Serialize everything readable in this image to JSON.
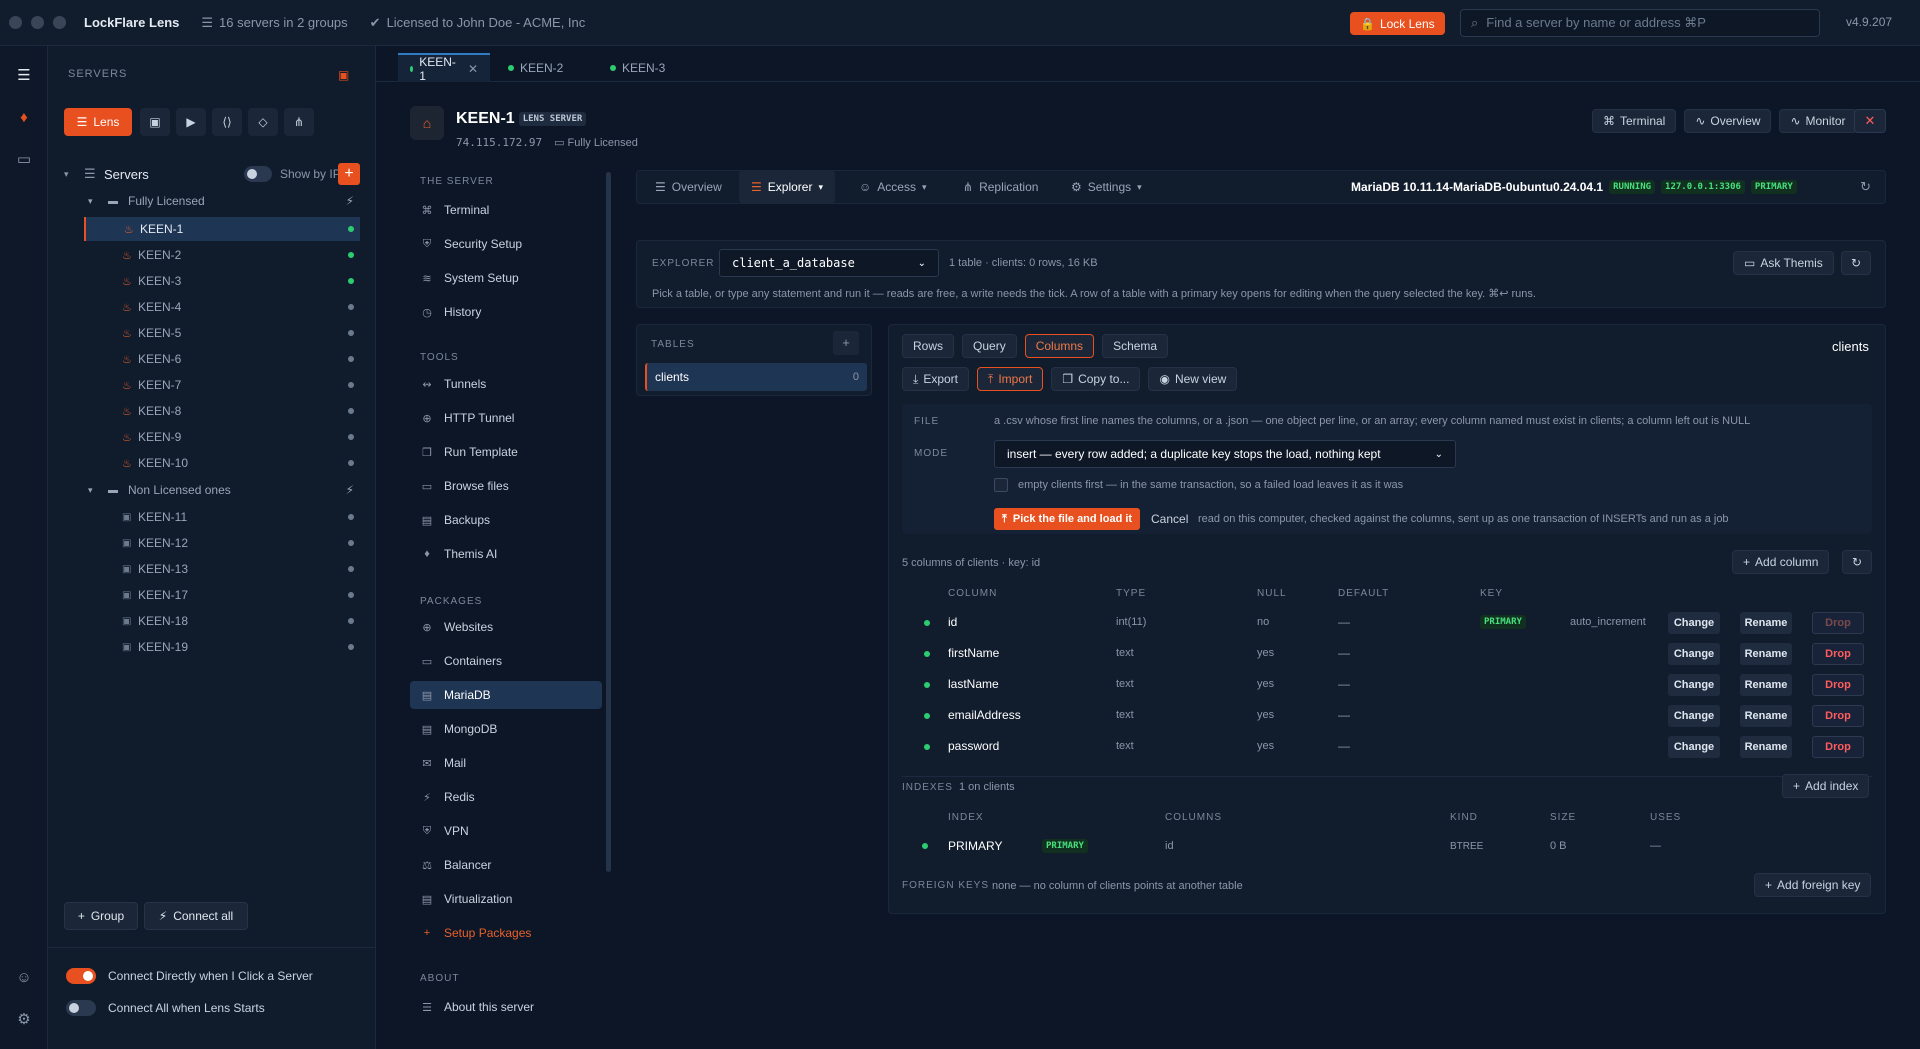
{
  "titlebar": {
    "app_title": "LockFlare Lens",
    "servers_info": "16 servers in 2 groups",
    "license_info": "Licensed to John Doe - ACME, Inc",
    "lock_label": "Lock Lens",
    "search_placeholder": "Find a server by name or address ⌘P",
    "version": "v4.9.207"
  },
  "sidebar": {
    "heading": "SERVERS",
    "lens_label": "Lens",
    "servers_label": "Servers",
    "show_by_ip": "Show by IP",
    "groups": [
      {
        "name": "Fully Licensed"
      },
      {
        "name": "Non Licensed ones"
      }
    ],
    "licensed_servers": [
      "KEEN-1",
      "KEEN-2",
      "KEEN-3",
      "KEEN-4",
      "KEEN-5",
      "KEEN-6",
      "KEEN-7",
      "KEEN-8",
      "KEEN-9",
      "KEEN-10"
    ],
    "unlicensed_servers": [
      "KEEN-11",
      "KEEN-12",
      "KEEN-13",
      "KEEN-17",
      "KEEN-18",
      "KEEN-19"
    ],
    "group_button": "Group",
    "connect_all_button": "Connect all",
    "opt_connect_direct": "Connect Directly when I Click a Server",
    "opt_connect_all_start": "Connect All when Lens Starts"
  },
  "tabs": [
    "KEEN-1",
    "KEEN-2",
    "KEEN-3"
  ],
  "server": {
    "name": "KEEN-1",
    "badge": "LENS SERVER",
    "ip": "74.115.172.97",
    "license": "Fully Licensed",
    "header_buttons": [
      "Terminal",
      "Overview",
      "Monitor"
    ]
  },
  "nav": {
    "sections": [
      "THE SERVER",
      "TOOLS",
      "PACKAGES",
      "ABOUT"
    ],
    "server_items": [
      "Terminal",
      "Security Setup",
      "System Setup",
      "History"
    ],
    "tool_items": [
      "Tunnels",
      "HTTP Tunnel",
      "Run Template",
      "Browse files",
      "Backups",
      "Themis AI"
    ],
    "package_items": [
      "Websites",
      "Containers",
      "MariaDB",
      "MongoDB",
      "Mail",
      "Redis",
      "VPN",
      "Balancer",
      "Virtualization",
      "Setup Packages"
    ],
    "about_items": [
      "About this server"
    ]
  },
  "db_tabs": [
    "Overview",
    "Explorer",
    "Access",
    "Replication",
    "Settings"
  ],
  "db_status": {
    "version": "MariaDB 10.11.14-MariaDB-0ubuntu0.24.04.1",
    "state": "RUNNING",
    "address": "127.0.0.1:3306",
    "role": "PRIMARY"
  },
  "explorer": {
    "label": "EXPLORER",
    "database": "client_a_database",
    "summary": "1 table · clients: 0 rows, 16 KB",
    "hint": "Pick a table, or type any statement and run it — reads are free, a write needs the tick. A row of a table with a primary key opens for editing when the query selected the key. ⌘↩ runs.",
    "ask_button": "Ask Themis"
  },
  "tables": {
    "heading": "TABLES",
    "items": [
      {
        "name": "clients",
        "count": "0"
      }
    ]
  },
  "view_tabs": [
    "Rows",
    "Query",
    "Columns",
    "Schema"
  ],
  "table_title": "clients",
  "action_buttons": [
    "Export",
    "Import",
    "Copy to...",
    "New view"
  ],
  "import": {
    "file_label": "FILE",
    "file_text": "a .csv whose first line names the columns, or a .json — one object per line, or an array; every column named must exist in clients; a column left out is NULL",
    "mode_label": "MODE",
    "mode_value": "insert — every row added; a duplicate key stops the load, nothing kept",
    "empty_first": "empty clients first — in the same transaction, so a failed load leaves it as it was",
    "pick_button": "Pick the file and load it",
    "cancel": "Cancel",
    "note": "read on this computer, checked against the columns, sent up as one transaction of INSERTs and run as a job"
  },
  "columns": {
    "summary": "5 columns of clients · key: id",
    "add_button": "Add column",
    "headers": [
      "COLUMN",
      "TYPE",
      "NULL",
      "DEFAULT",
      "KEY"
    ],
    "rows": [
      {
        "name": "id",
        "type": "int(11)",
        "null": "no",
        "default": "—",
        "key": "PRIMARY",
        "extra": "auto_increment"
      },
      {
        "name": "firstName",
        "type": "text",
        "null": "yes",
        "default": "—",
        "key": "",
        "extra": ""
      },
      {
        "name": "lastName",
        "type": "text",
        "null": "yes",
        "default": "—",
        "key": "",
        "extra": ""
      },
      {
        "name": "emailAddress",
        "type": "text",
        "null": "yes",
        "default": "—",
        "key": "",
        "extra": ""
      },
      {
        "name": "password",
        "type": "text",
        "null": "yes",
        "default": "—",
        "key": "",
        "extra": ""
      }
    ],
    "row_actions": [
      "Change",
      "Rename",
      "Drop"
    ]
  },
  "indexes": {
    "label": "INDEXES",
    "summary": "1 on clients",
    "add_button": "Add index",
    "headers": [
      "INDEX",
      "COLUMNS",
      "KIND",
      "SIZE",
      "USES"
    ],
    "rows": [
      {
        "name": "PRIMARY",
        "tag": "PRIMARY",
        "columns": "id",
        "kind": "BTREE",
        "size": "0 B",
        "uses": "—"
      }
    ]
  },
  "foreign_keys": {
    "label": "FOREIGN KEYS",
    "text": "none — no column of clients points at another table",
    "add_button": "Add foreign key"
  }
}
